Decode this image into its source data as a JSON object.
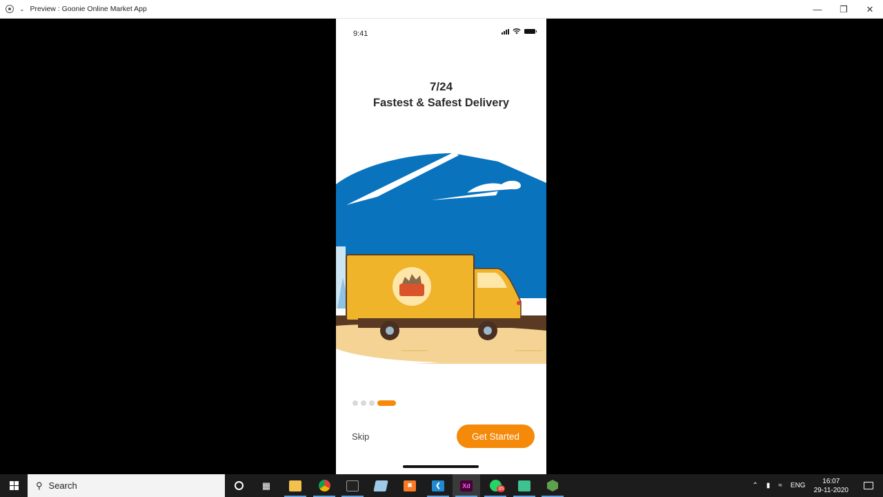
{
  "window": {
    "title": "Preview : Goonie Online Market App",
    "minimize": "—",
    "restore": "❐",
    "close": "✕"
  },
  "phone": {
    "status_time": "9:41",
    "headline_line1": "7/24",
    "headline_line2": "Fastest & Safest Delivery",
    "pager": {
      "total": 4,
      "active_index": 3
    },
    "skip_label": "Skip",
    "cta_label": "Get Started"
  },
  "colors": {
    "accent": "#f5890a",
    "sky": "#0a73bd",
    "truck": "#f0b42a",
    "ground": "#f4d394"
  },
  "taskbar": {
    "search_placeholder": "Search",
    "pinned": [
      {
        "name": "cortana-icon"
      },
      {
        "name": "task-view-icon"
      },
      {
        "name": "file-explorer-icon"
      },
      {
        "name": "chrome-icon"
      },
      {
        "name": "terminal-icon"
      },
      {
        "name": "notepad-icon"
      },
      {
        "name": "xampp-icon"
      },
      {
        "name": "vscode-icon"
      },
      {
        "name": "adobe-xd-icon",
        "label": "Xd"
      },
      {
        "name": "whatsapp-icon",
        "badge": "35"
      },
      {
        "name": "app-icon"
      },
      {
        "name": "nodejs-icon"
      }
    ],
    "tray": {
      "language": "ENG",
      "time": "16:07",
      "date": "29-11-2020"
    }
  }
}
